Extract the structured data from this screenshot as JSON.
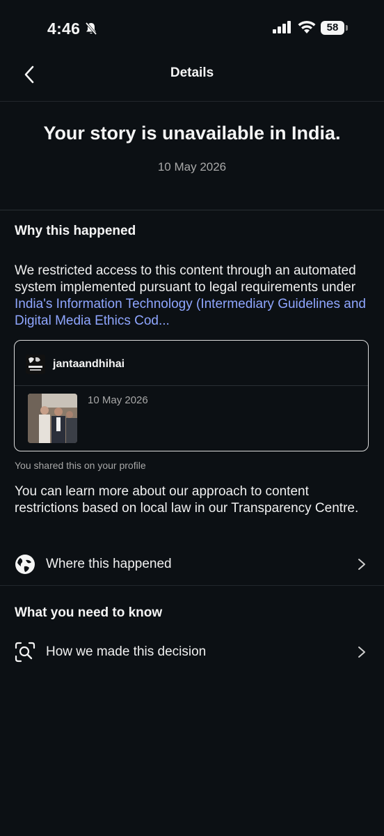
{
  "status_bar": {
    "time": "4:46",
    "battery": "58"
  },
  "nav": {
    "title": "Details"
  },
  "header": {
    "headline": "Your story is unavailable in India.",
    "date": "10 May 2026"
  },
  "why": {
    "title": "Why this happened",
    "text": "We restricted access to this content through an automated system implemented pursuant to legal requirements under ",
    "link": "India's Information Technology (Intermediary Guidelines and Digital Media Ethics Cod..."
  },
  "card": {
    "username": "jantaandhihai",
    "date": "10 May 2026"
  },
  "shared_note": "You shared this on your profile",
  "learn_more": "You can learn more about our approach to content restrictions based on local law in our Transparency Centre.",
  "where_row": {
    "label": "Where this happened",
    "icon": "globe-icon"
  },
  "need_to_know": {
    "title": "What you need to know",
    "row": {
      "label": "How we made this decision",
      "icon": "magnify-scan-icon"
    }
  }
}
